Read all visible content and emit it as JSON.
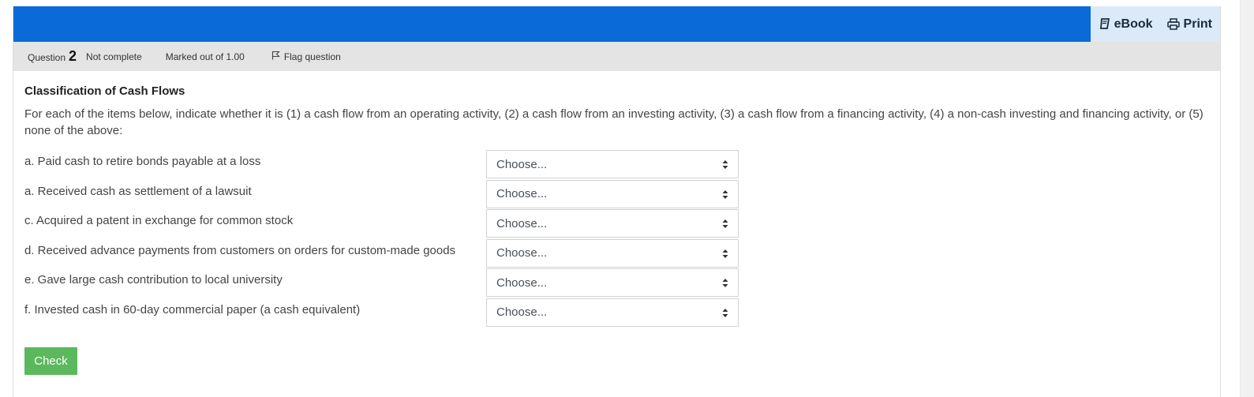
{
  "header": {
    "ebook_label": "eBook",
    "print_label": "Print"
  },
  "info": {
    "question_word": "Question",
    "question_number": "2",
    "state": "Not complete",
    "grade": "Marked out of 1.00",
    "flag_label": "Flag question"
  },
  "question": {
    "title": "Classification of Cash Flows",
    "instructions": "For each of the items below, indicate whether it is (1) a cash flow from an operating activity, (2) a cash flow from an investing activity, (3) a cash flow from a financing activity, (4) a non-cash investing and financing activity, or (5) none of the above:",
    "items": [
      {
        "label": "a. Paid cash to retire bonds payable at a loss",
        "selected": "Choose..."
      },
      {
        "label": "a. Received cash as settlement of a lawsuit",
        "selected": "Choose..."
      },
      {
        "label": "c. Acquired a patent in exchange for common stock",
        "selected": "Choose..."
      },
      {
        "label": "d. Received advance payments from customers on orders for custom-made goods",
        "selected": "Choose..."
      },
      {
        "label": "e. Gave large cash contribution to local university",
        "selected": "Choose..."
      },
      {
        "label": "f. Invested cash in 60-day commercial paper (a cash equivalent)",
        "selected": "Choose..."
      }
    ],
    "check_label": "Check"
  },
  "colors": {
    "topbar": "#0a6ad8",
    "tools_bg": "#dbeaf8",
    "infobar": "#e4e4e4",
    "check_button": "#5cb85c"
  },
  "icons": [
    "book-icon",
    "printer-icon",
    "flag-icon",
    "select-arrows-icon"
  ]
}
